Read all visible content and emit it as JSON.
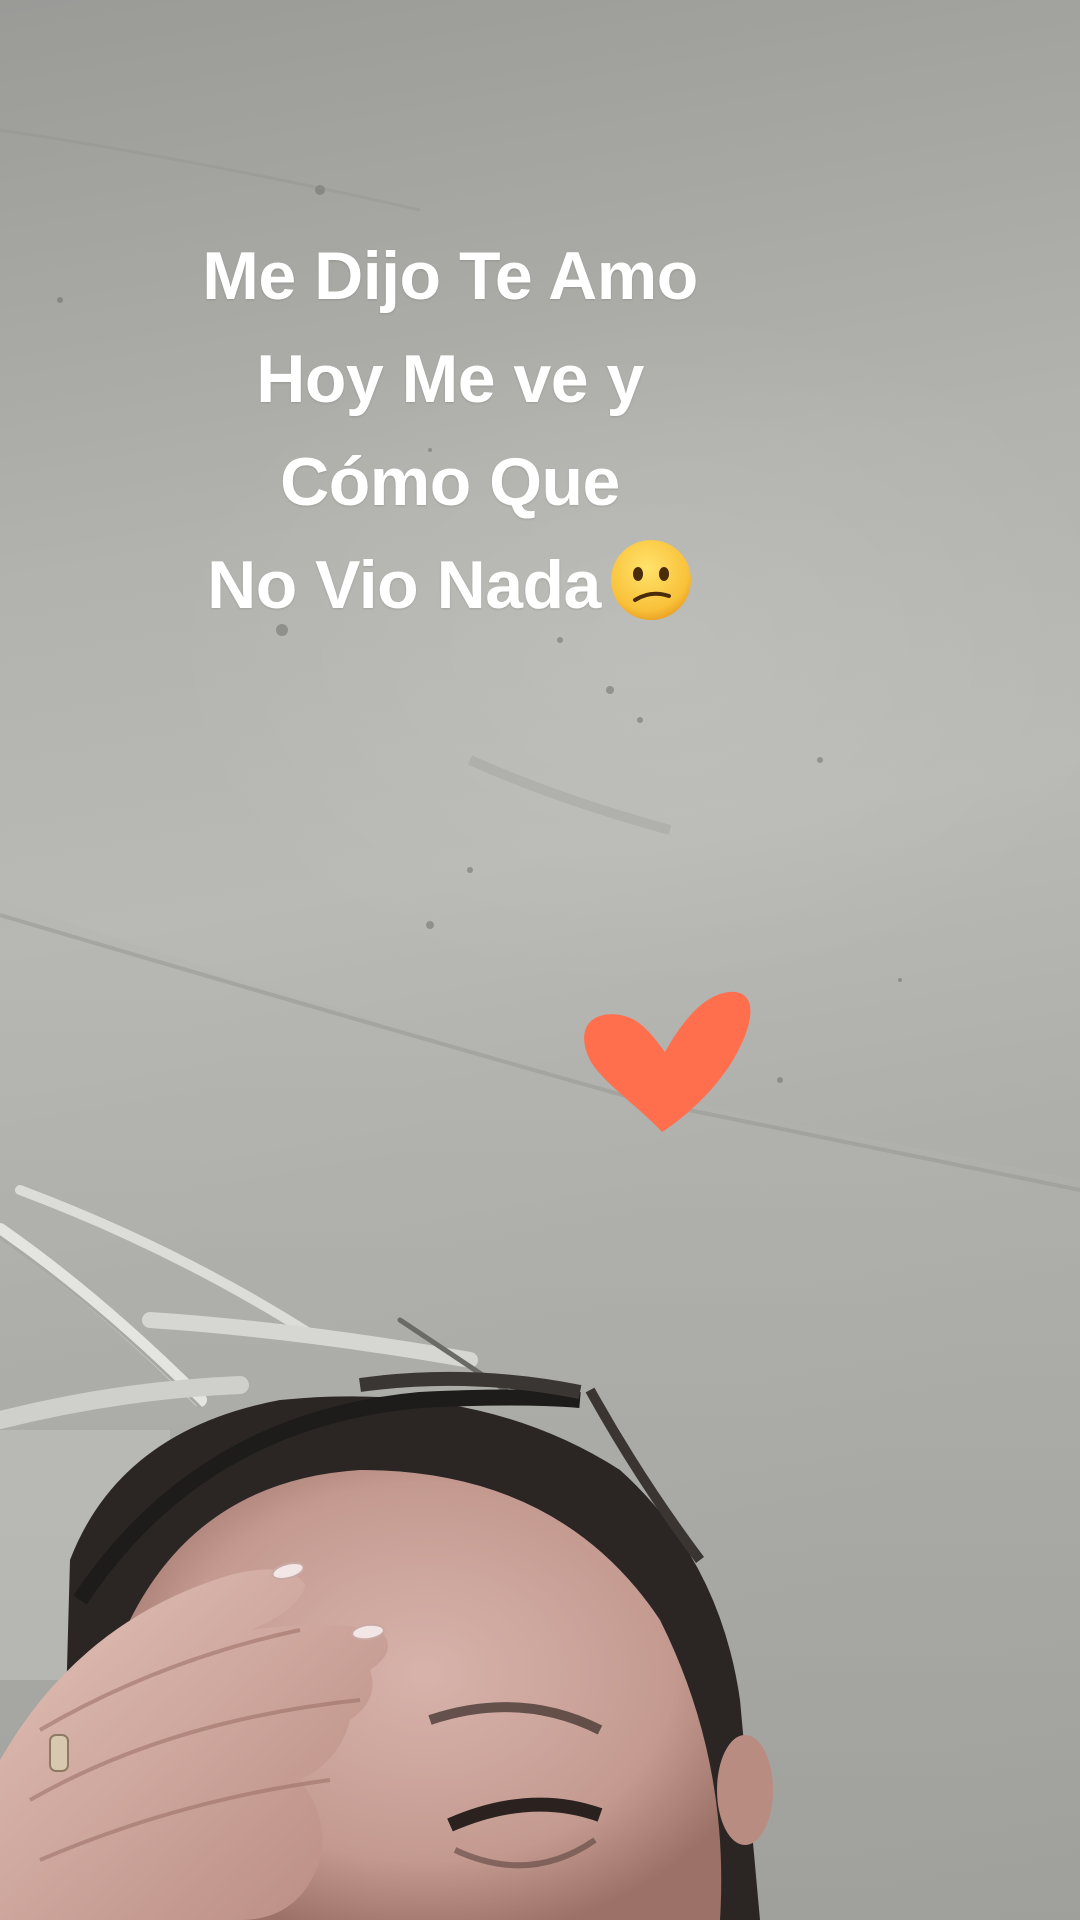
{
  "caption": {
    "lines": [
      "Me Dijo Te Amo",
      "Hoy Me ve y",
      "Cómo Que",
      "No Vio Nada"
    ],
    "emoji_icon": "confused-face-emoji"
  },
  "sticker": {
    "icon": "heart-icon",
    "color": "#FF6F4E"
  },
  "photo": {
    "subject": "woman-covering-forehead-with-hand",
    "wall_color": "#B4B4B0"
  }
}
